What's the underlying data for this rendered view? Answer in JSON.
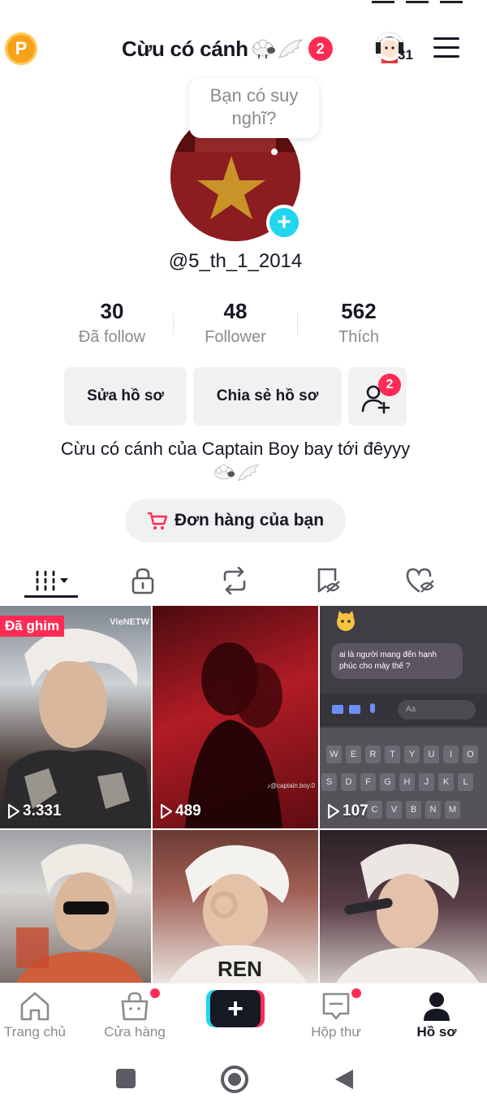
{
  "header": {
    "title": "Cừu có cánh",
    "notification_count": "2",
    "story_count": "31"
  },
  "profile": {
    "thought_bubble": "Bạn có suy nghĩ?",
    "username": "@5_th_1_2014",
    "stats": [
      {
        "value": "30",
        "label": "Đã follow"
      },
      {
        "value": "48",
        "label": "Follower"
      },
      {
        "value": "562",
        "label": "Thích"
      }
    ],
    "edit_button": "Sửa hồ sơ",
    "share_button": "Chia sẻ hồ sơ",
    "friend_requests_count": "2",
    "bio": "Cừu có cánh của Captain Boy bay tới đêyyy",
    "orders_button": "Đơn hàng của bạn"
  },
  "tabs": [
    {
      "icon": "grid-icon",
      "active": true
    },
    {
      "icon": "lock-icon",
      "active": false
    },
    {
      "icon": "repost-icon",
      "active": false
    },
    {
      "icon": "bookmark-hidden-icon",
      "active": false
    },
    {
      "icon": "liked-hidden-icon",
      "active": false
    }
  ],
  "videos": [
    {
      "views": "3.331",
      "pinned_label": "Đã ghim",
      "watermark": "VieNETW"
    },
    {
      "views": "489",
      "watermark": "♪@captain.boy.0"
    },
    {
      "views": "107",
      "chat_text": "ai là người mang đến hạnh phúc cho mày thế ?",
      "input_placeholder": "Aa"
    },
    {
      "views": ""
    },
    {
      "views": ""
    },
    {
      "views": ""
    }
  ],
  "bottom_nav": [
    {
      "label": "Trang chủ",
      "icon": "home-icon"
    },
    {
      "label": "Cửa hàng",
      "icon": "shop-icon"
    },
    {
      "label": "",
      "icon": "create-icon"
    },
    {
      "label": "Hộp thư",
      "icon": "inbox-icon"
    },
    {
      "label": "Hồ sơ",
      "icon": "profile-icon",
      "active": true
    }
  ],
  "colors": {
    "accent_red": "#fe2c55",
    "accent_cyan": "#20d5ec",
    "text_primary": "#161823",
    "text_secondary": "#8a8b91",
    "button_bg": "#f1f1f2"
  }
}
